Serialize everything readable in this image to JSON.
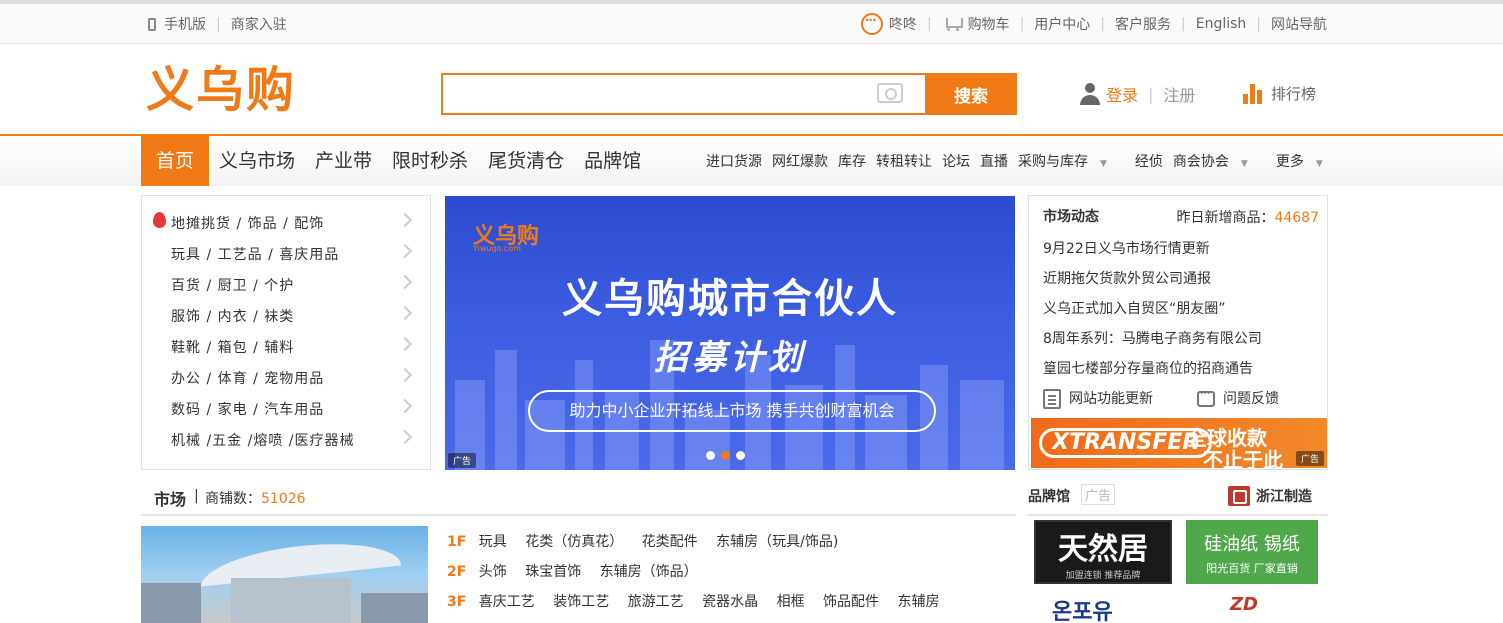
{
  "topbar": {
    "mobile": "手机版",
    "merchant": "商家入驻",
    "chat": "咚咚",
    "cart": "购物车",
    "user_center": "用户中心",
    "service": "客户服务",
    "english": "English",
    "sitemap": "网站导航"
  },
  "header": {
    "logo": "义乌购",
    "search_button": "搜索",
    "search_placeholder": "",
    "login": "登录",
    "register": "注册",
    "rank": "排行榜"
  },
  "nav": {
    "main": [
      "首页",
      "义乌市场",
      "产业带",
      "限时秒杀",
      "尾货清仓",
      "品牌馆"
    ],
    "sub": [
      "进口货源",
      "网红爆款",
      "库存",
      "转租转让",
      "论坛",
      "直播"
    ],
    "dropdowns": [
      "采购与库存",
      "商会协会",
      "更多"
    ],
    "extra": "经侦"
  },
  "categories": [
    "地摊挑货 / 饰品 / 配饰",
    "玩具 / 工艺品 / 喜庆用品",
    "百货 / 厨卫 / 个护",
    "服饰 / 内衣 / 袜类",
    "鞋靴 / 箱包 / 辅料",
    "办公 / 体育 / 宠物用品",
    "数码 / 家电 / 汽车用品",
    "机械 /五金 /熔喷 /医疗器械"
  ],
  "banner": {
    "logo": "义乌购",
    "logo_sub": "Yiwugo.com",
    "title": "义乌购城市合伙人",
    "subtitle": "招募计划",
    "pill": "助力中小企业开拓线上市场   携手共创财富机会",
    "ad": "广告",
    "slide_count": 3,
    "active_slide": 2
  },
  "news": {
    "title": "市场动态",
    "count_label": "昨日新增商品：",
    "count": "44687",
    "items": [
      "9月22日义乌市场行情更新",
      "近期拖欠货款外贸公司通报",
      "义乌正式加入自贸区“朋友圈”",
      "8周年系列：马腾电子商务有限公司",
      "篁园七楼部分存量商位的招商通告"
    ],
    "update": "网站功能更新",
    "feedback": "问题反馈",
    "ad_logo": "XTRANSFER",
    "ad_line1": "全球收款",
    "ad_line2": "不止于此",
    "ad_tag": "广告"
  },
  "market": {
    "title": "市场",
    "shop_label": "商铺数：",
    "shop_count": "51026",
    "floors": [
      {
        "f": "1F",
        "items": [
          "玩具",
          "花类（仿真花）",
          "花类配件",
          "东辅房（玩具/饰品)"
        ]
      },
      {
        "f": "2F",
        "items": [
          "头饰",
          "珠宝首饰",
          "东辅房（饰品）"
        ]
      },
      {
        "f": "3F",
        "items": [
          "喜庆工艺",
          "装饰工艺",
          "旅游工艺",
          "瓷器水晶",
          "相框",
          "饰品配件",
          "东辅房"
        ]
      }
    ]
  },
  "brands": {
    "title": "品牌馆",
    "ad": "广告",
    "zhejiang": "浙江制造",
    "b1_main": "天然居",
    "b1_sub": "加盟连锁  推荐品牌",
    "b2_main": "硅油纸 锡纸",
    "b2_sub": "阳光百货  厂家直销",
    "b3": "온포유",
    "b4": "ZD"
  },
  "colors": {
    "accent": "#f07a16"
  }
}
